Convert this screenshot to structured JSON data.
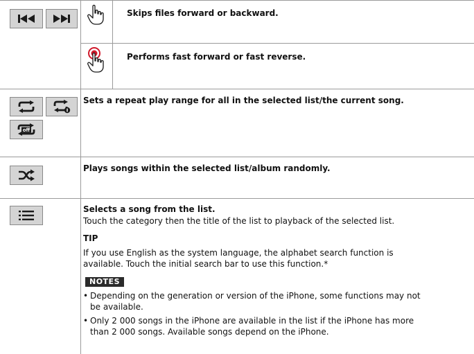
{
  "rows": [
    {
      "gestures": [
        {
          "icon": "tap-gesture-icon",
          "text": "Skips files forward or backward."
        },
        {
          "icon": "touch-hold-gesture-icon",
          "text": "Performs fast forward or fast reverse."
        }
      ],
      "buttons": [
        "skip-back-icon",
        "skip-forward-icon"
      ]
    },
    {
      "buttons": [
        "repeat-all-icon",
        "repeat-one-icon",
        "repeat-off-icon"
      ],
      "text": "Sets a repeat play range for all in the selected list/the current song."
    },
    {
      "buttons": [
        "shuffle-icon"
      ],
      "text": "Plays songs within the selected list/album randomly."
    },
    {
      "buttons": [
        "list-icon"
      ],
      "title": "Selects a song from the list.",
      "body": "Touch the category then the title of the list to playback of the selected list.",
      "tip_heading": "TIP",
      "tip_line1": "If you use English as the system language, the alphabet search function is",
      "tip_line2": "available. Touch the initial search bar to use this function.*",
      "notes_label": "NOTES",
      "notes": [
        {
          "line1": "Depending on the generation or version of the iPhone, some functions may not",
          "line2": "be available."
        },
        {
          "line1": "Only 2 000 songs in the iPhone are available in the list if the iPhone has more",
          "line2": "than 2 000 songs. Available songs depend on the iPhone."
        }
      ]
    }
  ],
  "colors": {
    "button_fill": "#d4d4d4",
    "rule": "#9a9a9a",
    "accent_red": "#d0192b"
  }
}
